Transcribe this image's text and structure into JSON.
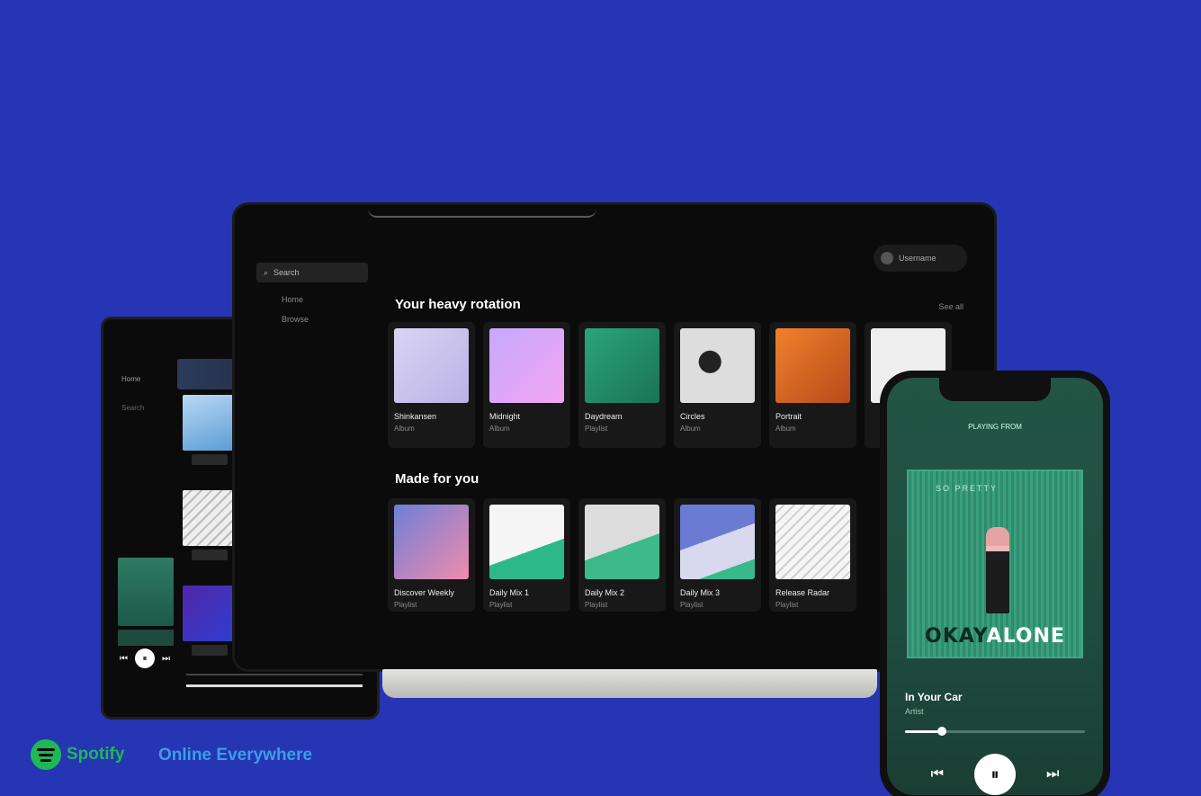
{
  "laptop": {
    "sidebar": {
      "search_label": "Search",
      "nav_items": [
        "Home",
        "Browse"
      ]
    },
    "profile_label": "Username",
    "section1": {
      "title": "Your heavy rotation",
      "see_all": "See all",
      "cards": [
        {
          "title": "Shinkansen",
          "sub": "Album"
        },
        {
          "title": "Midnight",
          "sub": "Album"
        },
        {
          "title": "Daydream",
          "sub": "Playlist"
        },
        {
          "title": "Circles",
          "sub": "Album"
        },
        {
          "title": "Portrait",
          "sub": "Album"
        },
        {
          "title": "",
          "sub": ""
        }
      ]
    },
    "section2": {
      "title": "Made for you",
      "cards": [
        {
          "title": "Discover Weekly",
          "sub": "Playlist"
        },
        {
          "title": "Daily Mix 1",
          "sub": "Playlist"
        },
        {
          "title": "Daily Mix 2",
          "sub": "Playlist"
        },
        {
          "title": "Daily Mix 3",
          "sub": "Playlist"
        },
        {
          "title": "Release Radar",
          "sub": "Playlist"
        }
      ]
    }
  },
  "tablet": {
    "sidebar_items": [
      "Home",
      "Search"
    ]
  },
  "phone": {
    "header": "PLAYING FROM",
    "album_top_text": "SO PRETTY",
    "album_title_a": "OKAY",
    "album_title_b": "ALONE",
    "song_title": "In Your Car",
    "song_artist": "Artist",
    "progress": 0.2
  },
  "brand": {
    "name": "Spotify",
    "tagline": "Online Everywhere"
  },
  "colors": {
    "background": "#2535b3",
    "spotify_green": "#1db954",
    "tagline_blue": "#3b9ee6"
  }
}
